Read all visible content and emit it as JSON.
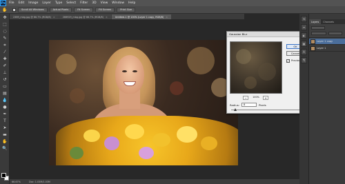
{
  "app": {
    "logo": "Ps",
    "menu": [
      "File",
      "Edit",
      "Image",
      "Layer",
      "Type",
      "Select",
      "Filter",
      "3D",
      "View",
      "Window",
      "Help"
    ]
  },
  "options_bar": {
    "scroll_all_windows": "Scroll All Windows",
    "actual_pixels": "Actual Pixels",
    "fit_screen": "Fit Screen",
    "fill_screen": "Fill Screen",
    "print_size": "Print Size"
  },
  "tabs": [
    {
      "label": "2389_mbg.jpg @ 66.7% (RGB/8)",
      "close": "×"
    },
    {
      "label": "266929_mbg.jpg @ 66.7% (RGB/8)",
      "close": "×"
    },
    {
      "label": "Untitled-1 @ 100% (Layer 1 copy, RGB/8)",
      "close": "×",
      "active": true
    }
  ],
  "dialog": {
    "title": "Gaussian Blur",
    "close": "×",
    "ok_label": "OK",
    "cancel_label": "Cancel",
    "preview_label": "Preview",
    "preview_checked": true,
    "preview_check_glyph": "✓",
    "zoom_minus": "−",
    "zoom_value": "100%",
    "zoom_plus": "+",
    "radius_label": "Radius:",
    "radius_value": "8",
    "radius_units": "Pixels"
  },
  "panels": {
    "tabs": [
      "Layers",
      "Channels"
    ],
    "layers": [
      {
        "name": "Layer 1 copy",
        "selected": true
      },
      {
        "name": "Layer 1",
        "selected": false
      }
    ]
  },
  "status": {
    "zoom": "66.67%",
    "doc": "Doc: 1.03M/1.03M"
  }
}
